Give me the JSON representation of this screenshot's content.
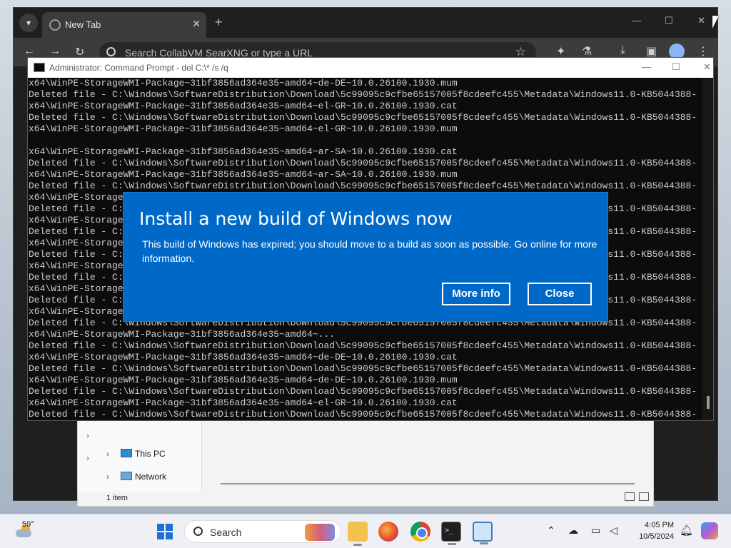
{
  "browser": {
    "tab_title": "New Tab",
    "new_tab_glyph": "+",
    "close_glyph": "✕",
    "omnibox_placeholder": "Search CollabVM SearXNG or type a URL",
    "icons": [
      "back-icon",
      "forward-icon",
      "reload-icon",
      "star-icon",
      "extensions-icon",
      "labs-icon",
      "download-icon",
      "sidebar-icon",
      "profile-icon",
      "menu-icon"
    ]
  },
  "cmd": {
    "title": "Administrator: Command Prompt - del  C:\\* /s /q",
    "lines": [
      "x64\\WinPE-StorageWMI-Package~31bf3856ad364e35~amd64~de-DE~10.0.26100.1930.mum",
      "Deleted file - C:\\Windows\\SoftwareDistribution\\Download\\5c99095c9cfbe65157005f8cdeefc455\\Metadata\\Windows11.0-KB5044388-",
      "x64\\WinPE-StorageWMI-Package~31bf3856ad364e35~amd64~el-GR~10.0.26100.1930.cat",
      "Deleted file - C:\\Windows\\SoftwareDistribution\\Download\\5c99095c9cfbe65157005f8cdeefc455\\Metadata\\Windows11.0-KB5044388-",
      "x64\\WinPE-StorageWMI-Package~31bf3856ad364e35~amd64~el-GR~10.0.26100.1930.mum",
      "",
      "x64\\WinPE-StorageWMI-Package~31bf3856ad364e35~amd64~ar-SA~10.0.26100.1930.cat",
      "Deleted file - C:\\Windows\\SoftwareDistribution\\Download\\5c99095c9cfbe65157005f8cdeefc455\\Metadata\\Windows11.0-KB5044388-",
      "x64\\WinPE-StorageWMI-Package~31bf3856ad364e35~amd64~ar-SA~10.0.26100.1930.mum",
      "Deleted file - C:\\Windows\\SoftwareDistribution\\Download\\5c99095c9cfbe65157005f8cdeefc455\\Metadata\\Windows11.0-KB5044388-",
      "x64\\WinPE-StorageWMI-Package~31bf3856ad364e35~amd64~...",
      "Deleted file - C:\\Windows\\SoftwareDistribution\\Download\\5c99095c9cfbe65157005f8cdeefc455\\Metadata\\Windows11.0-KB5044388-",
      "x64\\WinPE-StorageWMI-Package~31bf3856ad364e35~amd64~...",
      "Deleted file - C:\\Windows\\SoftwareDistribution\\Download\\5c99095c9cfbe65157005f8cdeefc455\\Metadata\\Windows11.0-KB5044388-",
      "x64\\WinPE-StorageWMI-Package~31bf3856ad364e35~amd64~...",
      "Deleted file - C:\\Windows\\SoftwareDistribution\\Download\\5c99095c9cfbe65157005f8cdeefc455\\Metadata\\Windows11.0-KB5044388-",
      "x64\\WinPE-StorageWMI-Package~31bf3856ad364e35~amd64~...",
      "Deleted file - C:\\Windows\\SoftwareDistribution\\Download\\5c99095c9cfbe65157005f8cdeefc455\\Metadata\\Windows11.0-KB5044388-",
      "x64\\WinPE-StorageWMI-Package~31bf3856ad364e35~amd64~...",
      "Deleted file - C:\\Windows\\SoftwareDistribution\\Download\\5c99095c9cfbe65157005f8cdeefc455\\Metadata\\Windows11.0-KB5044388-",
      "x64\\WinPE-StorageWMI-Package~31bf3856ad364e35~amd64~...",
      "Deleted file - C:\\Windows\\SoftwareDistribution\\Download\\5c99095c9cfbe65157005f8cdeefc455\\Metadata\\Windows11.0-KB5044388-",
      "x64\\WinPE-StorageWMI-Package~31bf3856ad364e35~amd64~...",
      "Deleted file - C:\\Windows\\SoftwareDistribution\\Download\\5c99095c9cfbe65157005f8cdeefc455\\Metadata\\Windows11.0-KB5044388-",
      "x64\\WinPE-StorageWMI-Package~31bf3856ad364e35~amd64~de-DE~10.0.26100.1930.cat",
      "Deleted file - C:\\Windows\\SoftwareDistribution\\Download\\5c99095c9cfbe65157005f8cdeefc455\\Metadata\\Windows11.0-KB5044388-",
      "x64\\WinPE-StorageWMI-Package~31bf3856ad364e35~amd64~de-DE~10.0.26100.1930.mum",
      "Deleted file - C:\\Windows\\SoftwareDistribution\\Download\\5c99095c9cfbe65157005f8cdeefc455\\Metadata\\Windows11.0-KB5044388-",
      "x64\\WinPE-StorageWMI-Package~31bf3856ad364e35~amd64~el-GR~10.0.26100.1930.cat",
      "Deleted file - C:\\Windows\\SoftwareDistribution\\Download\\5c99095c9cfbe65157005f8cdeefc455\\Metadata\\Windows11.0-KB5044388-",
      "x64\\WinPE-StorageWMI-Package~31bf3856ad364e35~amd64~el-GR~10.0.26100.1930.mum"
    ]
  },
  "dialog": {
    "title": "Install a new build of Windows now",
    "body": "This build of Windows has expired; you should move to a build as soon as possible. Go online for more information.",
    "more_info_label": "More info",
    "close_label": "Close",
    "accent": "#0069c8"
  },
  "explorer": {
    "nav_items": [
      "This PC",
      "Network"
    ],
    "status": "1 item"
  },
  "taskbar": {
    "temperature": "59°",
    "search_label": "Search",
    "time": "4:05 PM",
    "date": "10/5/2024",
    "apps": [
      "file-explorer-icon",
      "firefox-icon",
      "chrome-icon",
      "terminal-icon",
      "window-icon"
    ]
  }
}
